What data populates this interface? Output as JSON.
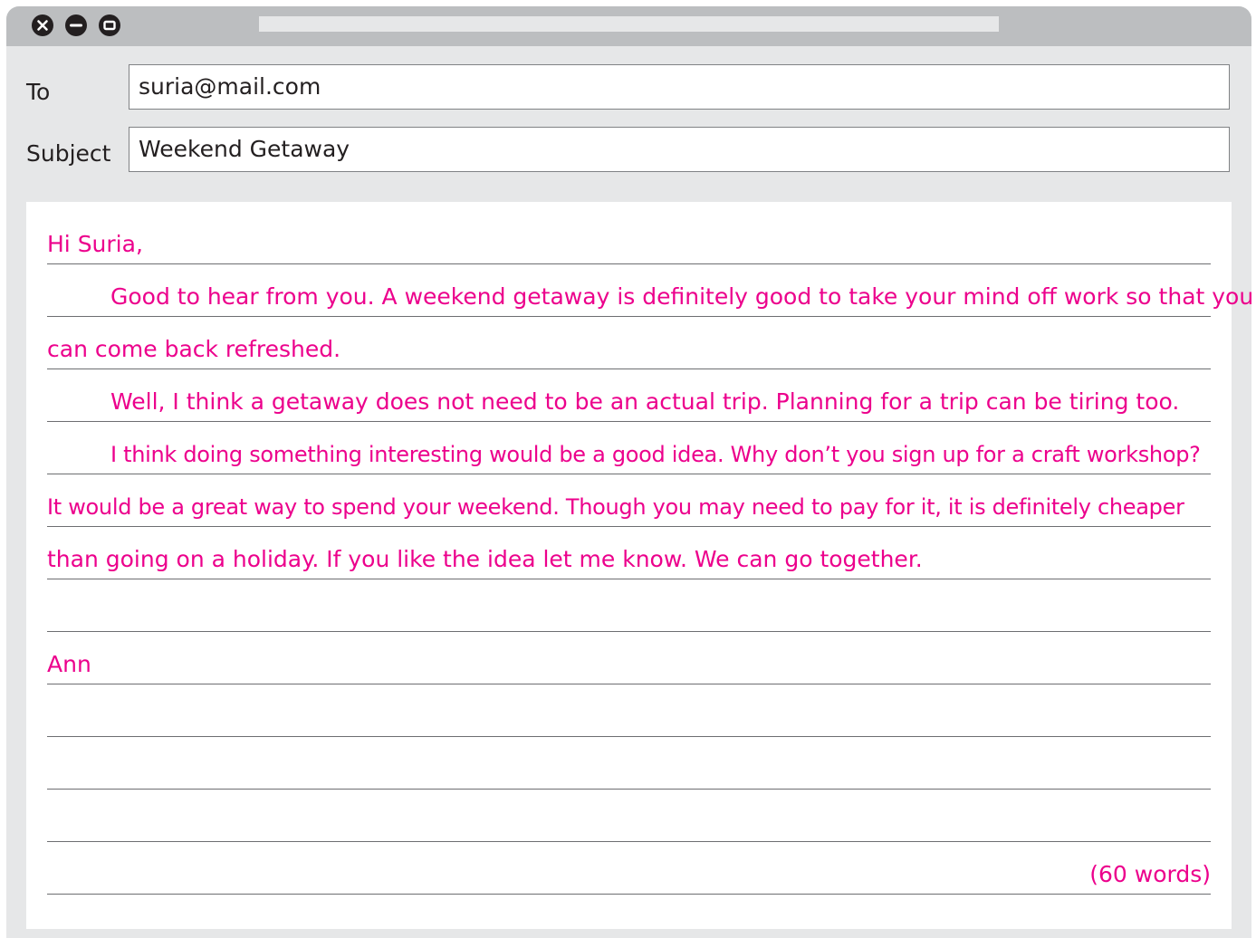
{
  "window": {
    "controls": [
      "close-icon",
      "minimize-icon",
      "maximize-icon"
    ]
  },
  "header": {
    "to_label": "To",
    "to_value": "suria@mail.com",
    "subject_label": "Subject",
    "subject_value": "Weekend Getaway"
  },
  "body": {
    "greeting": "Hi Suria,",
    "lines": [
      "Good to hear from you. A weekend getaway is definitely good to take your mind off work so that you",
      "can come back refreshed.",
      "Well, I think a getaway does not need to be an actual trip. Planning for a trip can be tiring too.",
      "I think doing something interesting would be a good idea. Why don’t you sign up for a craft workshop?",
      "It would be a great way to spend your weekend. Though you may need to pay for it, it is definitely cheaper",
      "than going on a holiday. If you like the idea let me know. We can go together."
    ],
    "signature": "Ann",
    "word_count": "(60 words)"
  },
  "colors": {
    "text_accent": "#ec008c",
    "window_bg": "#e6e7e8",
    "titlebar_bg": "#bcbec0"
  }
}
